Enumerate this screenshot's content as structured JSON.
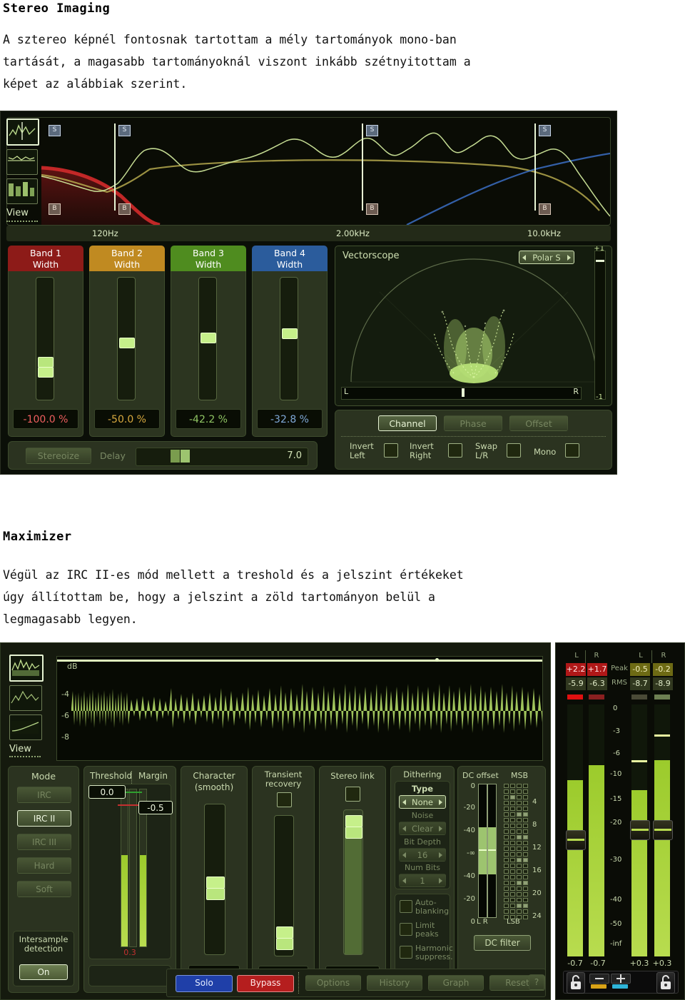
{
  "doc": {
    "section1_heading": "Stereo Imaging",
    "section1_lines": [
      "A sztereo képnél fontosnak tartottam a mély tartományok mono-ban",
      "tartását, a magasabb tartományoknál viszont inkább szétnyitottam a",
      "képet az alábbiak szerint."
    ],
    "section2_heading": "Maximizer",
    "section2_lines": [
      "Végül az IRC II-es mód mellett a treshold és a jelszint értékeket",
      "úgy állítottam be, hogy a jelszint a zöld tartományon belül a",
      "legmagasabb legyen."
    ]
  },
  "stereo_imaging": {
    "view_label": "View",
    "crossovers": [
      {
        "freq": "120Hz",
        "solo": "S",
        "bypass": "B"
      },
      {
        "freq": "2.00kHz",
        "solo": "S",
        "bypass": "B"
      },
      {
        "freq": "10.0kHz",
        "solo": "S",
        "bypass": "B"
      }
    ],
    "bands": [
      {
        "title": "Band 1",
        "sub": "Width",
        "value": "-100.0 %",
        "color": "#8d1b18",
        "text_color": "#ef5f5f",
        "thumb_pct": 78
      },
      {
        "title": "Band 2",
        "sub": "Width",
        "value": "-50.0 %",
        "color": "#c08a21",
        "text_color": "#d8a93f",
        "thumb_pct": 56
      },
      {
        "title": "Band 3",
        "sub": "Width",
        "value": "-42.2 %",
        "color": "#4f8c1f",
        "text_color": "#8fc463",
        "thumb_pct": 52
      },
      {
        "title": "Band 4",
        "sub": "Width",
        "value": "-32.8 %",
        "color": "#2b5c9c",
        "text_color": "#7fa8d8",
        "thumb_pct": 48
      }
    ],
    "stereoize_label": "Stereoize",
    "delay_label": "Delay",
    "delay_value": "7.0",
    "vectorscope": {
      "title": "Vectorscope",
      "mode": "Polar S",
      "scale_top": "+1",
      "scale_bottom": "-1",
      "left_label": "L",
      "right_label": "R"
    },
    "tabs": [
      {
        "label": "Channel",
        "selected": true
      },
      {
        "label": "Phase",
        "selected": false
      },
      {
        "label": "Offset",
        "selected": false
      }
    ],
    "checks": [
      {
        "label1": "Invert",
        "label2": "Left"
      },
      {
        "label1": "Invert",
        "label2": "Right"
      },
      {
        "label1": "Swap",
        "label2": "L/R"
      },
      {
        "label1": "Mono",
        "label2": ""
      }
    ]
  },
  "maximizer": {
    "view_label": "View",
    "db_label": "dB",
    "wave_ticks": [
      "-4",
      "-6",
      "-8"
    ],
    "mode": {
      "title": "Mode",
      "options": [
        {
          "label": "IRC",
          "selected": false
        },
        {
          "label": "IRC II",
          "selected": true
        },
        {
          "label": "IRC III",
          "selected": false
        },
        {
          "label": "Hard",
          "selected": false
        },
        {
          "label": "Soft",
          "selected": false
        }
      ],
      "intersample_label1": "Intersample",
      "intersample_label2": "detection",
      "intersample_value": "On"
    },
    "threshold": {
      "label": "Threshold",
      "value": "0.0",
      "margin_label": "Margin",
      "margin_value": "-0.5",
      "reduction": "0.3"
    },
    "character": {
      "label": "Character",
      "sub": "(smooth)",
      "value": "3.0",
      "thumb_pct": 44
    },
    "transient": {
      "label1": "Transient",
      "label2": "recovery",
      "value": "0.0",
      "thumb_pct": 12
    },
    "stereo_link": {
      "label": "Stereo link",
      "value": "100.0 %",
      "thumb_pct": 88
    },
    "dithering": {
      "title": "Dithering",
      "type_label": "Type",
      "type_value": "None",
      "noise_label": "Noise Shaping",
      "noise_value": "Clear",
      "bit_label": "Bit Depth",
      "bit_value": "16",
      "num_label": "Num Bits",
      "num_value": "1",
      "checks": [
        {
          "l1": "Auto-",
          "l2": "blanking"
        },
        {
          "l1": "Limit",
          "l2": "peaks"
        },
        {
          "l1": "Harmonic",
          "l2": "suppress."
        }
      ]
    },
    "dc_offset": {
      "label": "DC offset",
      "ticks": [
        "0",
        "-20",
        "-40",
        "-∞",
        "-40",
        "-20",
        "0"
      ],
      "lr_label": "L  R",
      "filter_button": "DC filter"
    },
    "msb": {
      "label": "MSB",
      "lsb_label": "LSB",
      "ticks": [
        "4",
        "8",
        "12",
        "16",
        "20",
        "24"
      ]
    },
    "meters": {
      "in_l": "L",
      "in_r": "R",
      "out_l": "L",
      "out_r": "R",
      "peak_label": "Peak",
      "rms_label": "RMS",
      "in_peak_l": "+2.2",
      "in_peak_r": "+1.7",
      "in_rms_l": "-5.9",
      "in_rms_r": "-6.3",
      "out_peak_l": "-0.5",
      "out_peak_r": "-0.2",
      "out_rms_l": "-8.7",
      "out_rms_r": "-8.9",
      "scale": [
        "0",
        "-3",
        "-6",
        "-10",
        "-15",
        "-20",
        "-30",
        "-40",
        "-50",
        "-inf"
      ],
      "foot": [
        "-0.7",
        "-0.7",
        "+0.3",
        "+0.3"
      ]
    },
    "footer_buttons": [
      {
        "label": "Solo",
        "style": "solo"
      },
      {
        "label": "Bypass",
        "style": "bypass"
      },
      {
        "label": "Options",
        "style": "plain"
      },
      {
        "label": "History",
        "style": "plain"
      },
      {
        "label": "Graph",
        "style": "plain"
      },
      {
        "label": "Reset",
        "style": "plain"
      },
      {
        "label": "?",
        "style": "plain"
      }
    ]
  }
}
